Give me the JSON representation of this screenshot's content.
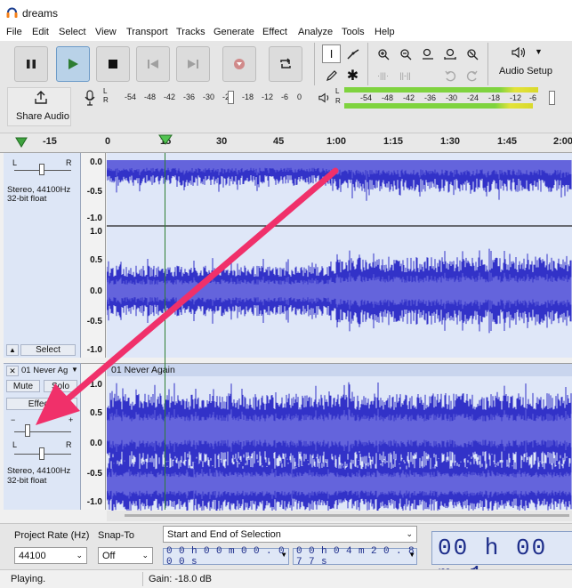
{
  "window": {
    "title": "dreams"
  },
  "menu": [
    "File",
    "Edit",
    "Select",
    "View",
    "Transport",
    "Tracks",
    "Generate",
    "Effect",
    "Analyze",
    "Tools",
    "Help"
  ],
  "toolbar": {
    "share_audio": "Share Audio",
    "audio_setup": "Audio Setup",
    "rec_meter_scale": [
      "-54",
      "-48",
      "-42",
      "-36",
      "-30",
      "-24",
      "-18",
      "-12",
      "-6",
      "0"
    ],
    "play_meter_scale": [
      "-54",
      "-48",
      "-42",
      "-36",
      "-30",
      "-24",
      "-18",
      "-12",
      "-6"
    ],
    "meter_channels": [
      "L",
      "R"
    ]
  },
  "timeline": {
    "labels": [
      "-15",
      "0",
      "15",
      "30",
      "45",
      "1:00",
      "1:15",
      "1:30",
      "1:45",
      "2:00"
    ]
  },
  "track1": {
    "format": "Stereo, 44100Hz",
    "bitdepth": "32-bit float",
    "pan_l": "L",
    "pan_r": "R",
    "select_button": "Select",
    "ruler_top": [
      "0.0",
      "-0.5",
      "-1.0"
    ],
    "ruler_bottom": [
      "1.0",
      "0.5",
      "0.0",
      "-0.5",
      "-1.0"
    ]
  },
  "track2": {
    "name": "01 Never Ag",
    "clip_name": "01 Never Again",
    "mute": "Mute",
    "solo": "Solo",
    "effects": "Effects",
    "gain_minus": "−",
    "gain_plus": "+",
    "pan_l": "L",
    "pan_r": "R",
    "format": "Stereo, 44100Hz",
    "bitdepth": "32-bit float",
    "ruler": [
      "1.0",
      "0.5",
      "0.0",
      "-0.5",
      "-1.0"
    ]
  },
  "selection_toolbar": {
    "project_rate_label": "Project Rate (Hz)",
    "project_rate_value": "44100",
    "snap_to_label": "Snap-To",
    "snap_to_value": "Off",
    "selection_mode": "Start and End of Selection",
    "start_time": "0 0 h 0 0 m 0 0 . 0 0 0 s",
    "end_time": "0 0 h 0 4 m 2 0 . 8 7 7 s",
    "big_time": "00 h 00 m 1"
  },
  "status": {
    "state": "Playing.",
    "gain": "Gain: -18.0 dB"
  },
  "colors": {
    "wave": "#3232c8",
    "wave_rms": "#6464dc",
    "arrow": "#f0306a",
    "track_bg": "#dfe7f8",
    "playhead": "#2e7d32"
  }
}
